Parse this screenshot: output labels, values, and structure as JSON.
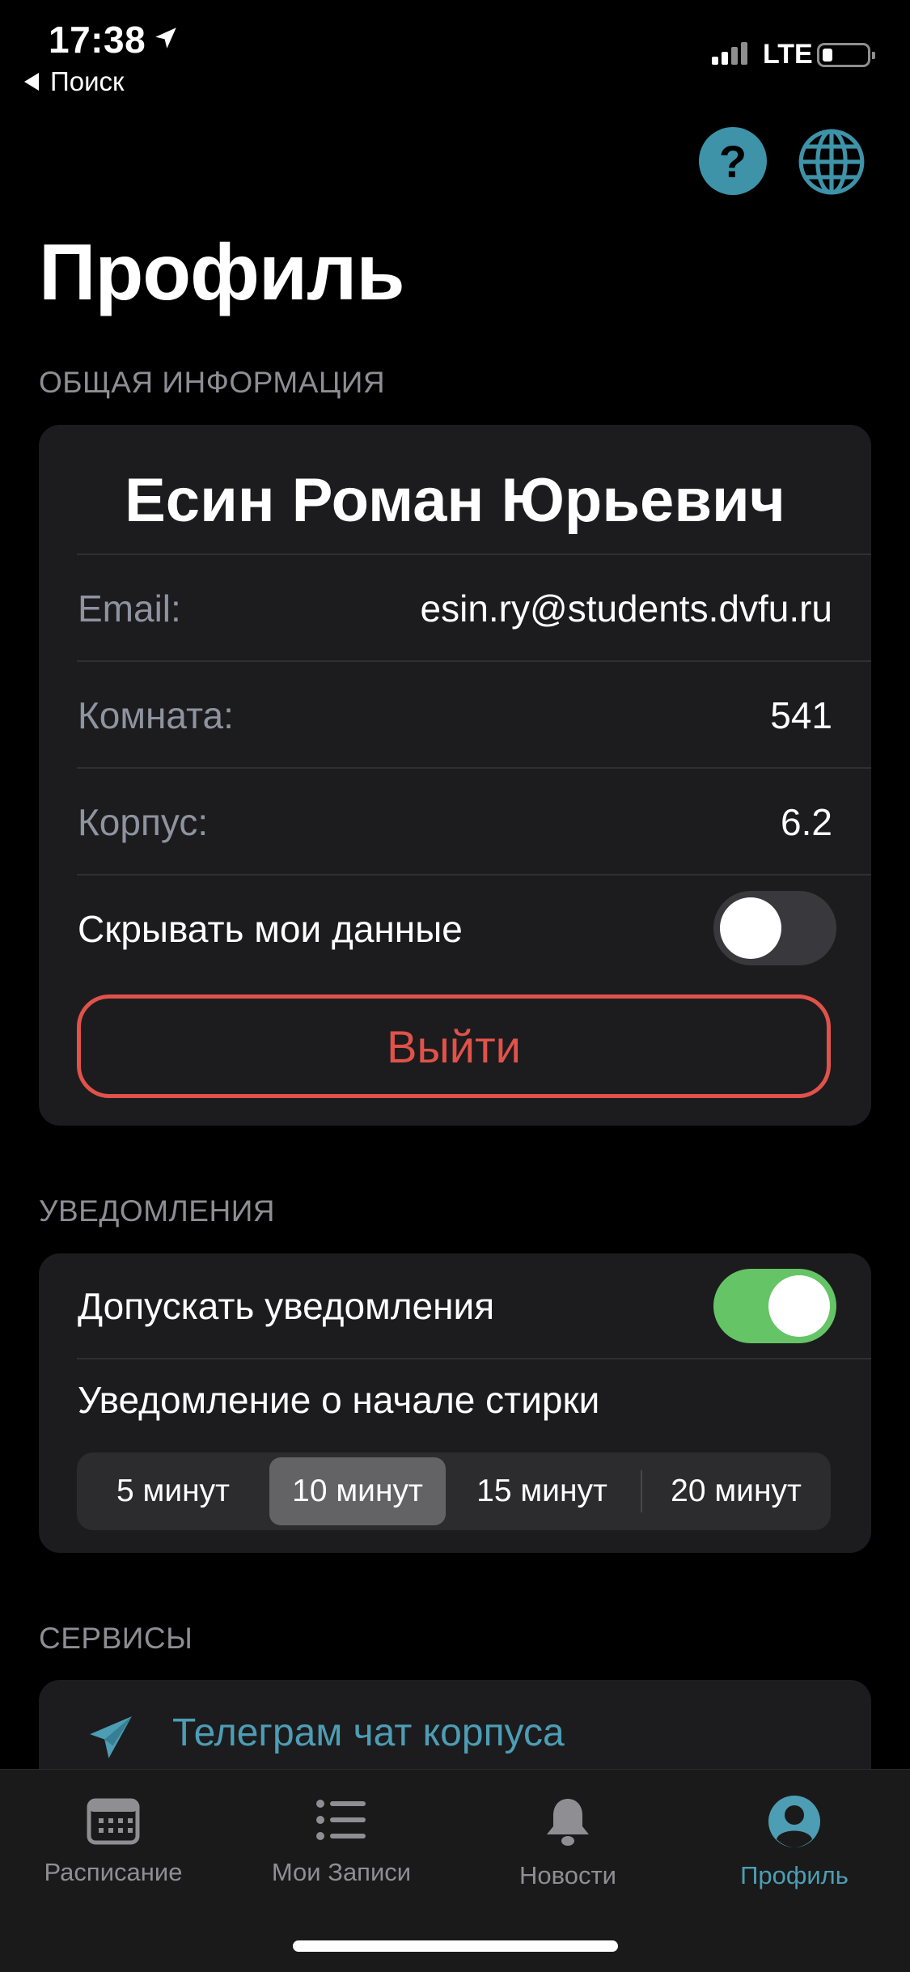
{
  "status_bar": {
    "time": "17:38",
    "network": "LTE",
    "back_label": "Поиск"
  },
  "header": {
    "title": "Профиль",
    "help_glyph": "?",
    "help_icon": "question-circle-icon",
    "language_icon": "globe-icon"
  },
  "general": {
    "section_label": "ОБЩАЯ ИНФОРМАЦИЯ",
    "full_name": "Есин Роман Юрьевич",
    "rows": [
      {
        "label": "Email:",
        "value": "esin.ry@students.dvfu.ru"
      },
      {
        "label": "Комната:",
        "value": "541"
      },
      {
        "label": "Корпус:",
        "value": "6.2"
      }
    ],
    "hide_data_label": "Скрывать мои данные",
    "hide_data_enabled": false,
    "logout_label": "Выйти"
  },
  "notifications": {
    "section_label": "УВЕДОМЛЕНИЯ",
    "allow_label": "Допускать уведомления",
    "allow_enabled": true,
    "wash_start_label": "Уведомление о начале стирки",
    "options": [
      "5 минут",
      "10 минут",
      "15 минут",
      "20 минут"
    ],
    "selected_option": "10 минут"
  },
  "services": {
    "section_label": "СЕРВИСЫ",
    "items": [
      {
        "label": "Телеграм чат корпуса",
        "icon": "telegram-icon"
      }
    ]
  },
  "tabbar": {
    "tabs": [
      {
        "label": "Расписание",
        "icon": "calendar-icon"
      },
      {
        "label": "Мои Записи",
        "icon": "list-icon"
      },
      {
        "label": "Новости",
        "icon": "bell-icon"
      },
      {
        "label": "Профиль",
        "icon": "person-circle-icon",
        "active": true
      }
    ]
  },
  "colors": {
    "accent": "#4d9db4",
    "danger": "#e0524a",
    "toggle_on": "#65c466",
    "card": "#1c1c1e"
  }
}
